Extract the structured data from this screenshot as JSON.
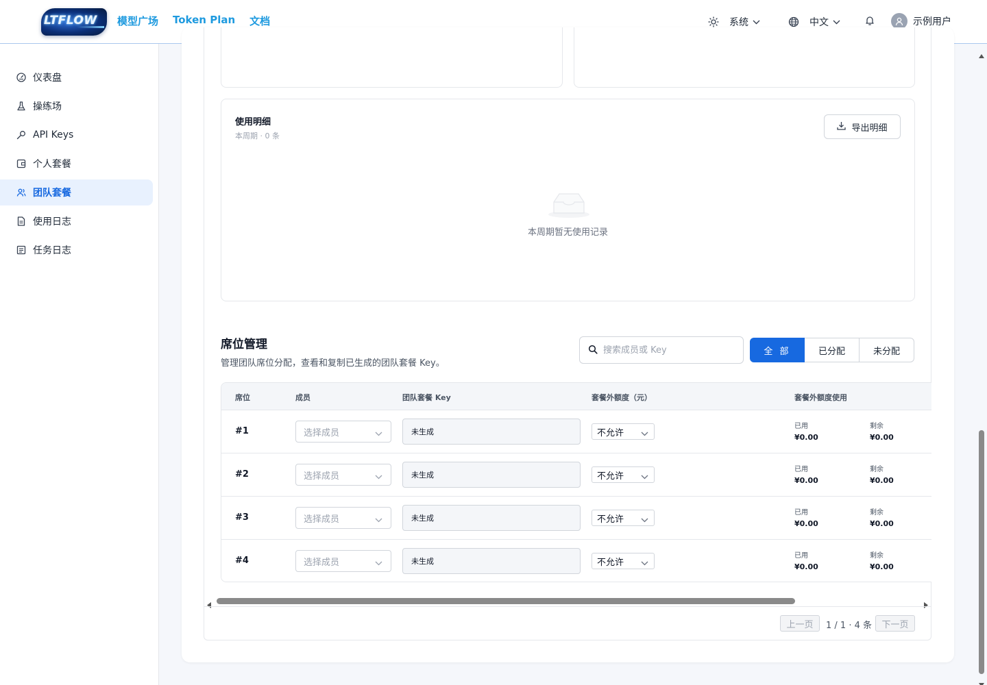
{
  "header": {
    "logo_text": "LTFLOW",
    "nav": [
      "模型广场",
      "Token Plan",
      "文档"
    ],
    "theme_label": "系统",
    "language_label": "中文",
    "user_name": "示例用户"
  },
  "sidebar": {
    "items": [
      {
        "label": "仪表盘",
        "icon": "dashboard-icon"
      },
      {
        "label": "操练场",
        "icon": "flask-icon"
      },
      {
        "label": "API Keys",
        "icon": "key-icon"
      },
      {
        "label": "个人套餐",
        "icon": "wallet-icon"
      },
      {
        "label": "团队套餐",
        "icon": "team-icon",
        "active": true
      },
      {
        "label": "使用日志",
        "icon": "document-icon"
      },
      {
        "label": "任务日志",
        "icon": "list-icon"
      }
    ]
  },
  "usage": {
    "title": "使用明细",
    "subtitle": "本周期 · 0 条",
    "export_label": "导出明细",
    "empty_text": "本周期暂无使用记录"
  },
  "seats": {
    "title": "席位管理",
    "description": "管理团队席位分配，查看和复制已生成的团队套餐 Key。",
    "search_placeholder": "搜索成员或 Key",
    "filters": [
      "全 部",
      "已分配",
      "未分配"
    ],
    "columns": [
      "席位",
      "成员",
      "团队套餐 Key",
      "套餐外额度（元）",
      "套餐外额度使用"
    ],
    "used_label": "已用",
    "remaining_label": "剩余",
    "rows": [
      {
        "seat": "#1",
        "member": "选择成员",
        "key": "未生成",
        "quota": "不允许",
        "used": "¥0.00",
        "remaining": "¥0.00"
      },
      {
        "seat": "#2",
        "member": "选择成员",
        "key": "未生成",
        "quota": "不允许",
        "used": "¥0.00",
        "remaining": "¥0.00"
      },
      {
        "seat": "#3",
        "member": "选择成员",
        "key": "未生成",
        "quota": "不允许",
        "used": "¥0.00",
        "remaining": "¥0.00"
      },
      {
        "seat": "#4",
        "member": "选择成员",
        "key": "未生成",
        "quota": "不允许",
        "used": "¥0.00",
        "remaining": "¥0.00"
      }
    ]
  },
  "pagination": {
    "prev_label": "上一页",
    "info": "1 / 1 · 4 条",
    "next_label": "下一页"
  },
  "colors": {
    "accent": "#1769e0",
    "nav_link": "#1e9adf",
    "active_bg": "#e8f1fe"
  }
}
